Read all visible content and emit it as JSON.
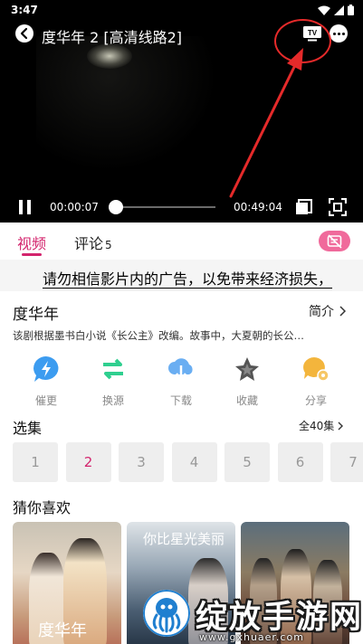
{
  "status_bar": {
    "time": "3:47"
  },
  "player": {
    "title": "度华年 2 [高清线路2]",
    "tv_label": "TV",
    "current_time": "00:00:07",
    "total_time": "00:49:04",
    "progress": 0.0024
  },
  "tabs": [
    {
      "label": "视频"
    },
    {
      "label": "评论",
      "count": "5"
    }
  ],
  "notice": "请勿相信影片内的广告，以免带来经济损失，",
  "show": {
    "title": "度华年",
    "intro_label": "简介",
    "synopsis": "该剧根据墨书白小说《长公主》改编。故事中，大夏朝的长公…"
  },
  "actions": [
    {
      "label": "催更",
      "icon": "lightning-bubble-icon",
      "color": "#3c9cf0"
    },
    {
      "label": "换源",
      "icon": "swap-arrows-icon",
      "color": "#2fcf8f"
    },
    {
      "label": "下载",
      "icon": "cloud-download-icon",
      "color": "#6aaef2"
    },
    {
      "label": "收藏",
      "icon": "star-icon",
      "color": "#555555"
    },
    {
      "label": "分享",
      "icon": "share-bubble-icon",
      "color": "#f3b53c"
    }
  ],
  "episodes": {
    "title": "选集",
    "all_label": "全40集",
    "items": [
      "1",
      "2",
      "3",
      "4",
      "5",
      "6",
      "7"
    ],
    "active": "2"
  },
  "recommend": {
    "title": "猜你喜欢",
    "posters": [
      {
        "caption": "度华年"
      },
      {
        "caption": "你比星光美丽"
      },
      {
        "caption": ""
      }
    ]
  },
  "watermark": {
    "main": "绽放手游网",
    "url": "www.gxhuaer.com"
  },
  "colors": {
    "accent": "#d3246d",
    "annotation": "#e52a2a"
  }
}
